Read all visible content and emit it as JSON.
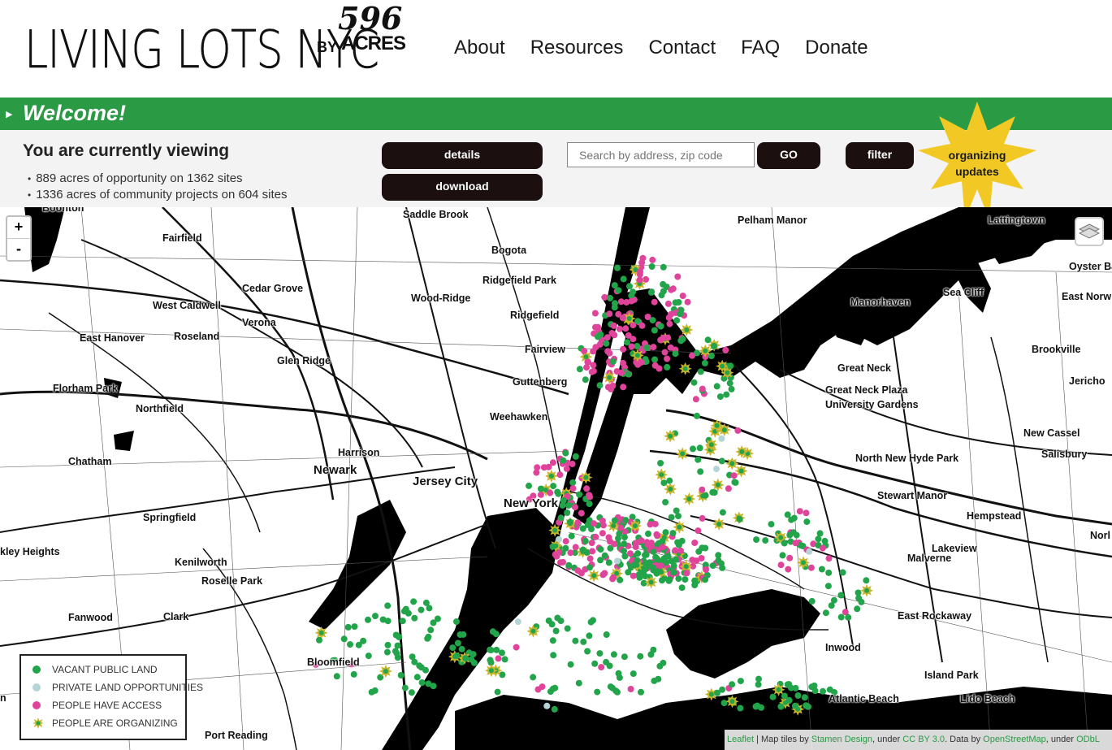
{
  "header": {
    "logo_main": "LIVING LOTS NYC",
    "logo_by": "BY",
    "logo_num": "596",
    "logo_acres": "ACRES",
    "nav": [
      "About",
      "Resources",
      "Contact",
      "FAQ",
      "Donate"
    ]
  },
  "welcome": {
    "title": "Welcome!"
  },
  "panel": {
    "heading": "You are currently viewing",
    "stats": [
      "889 acres of opportunity on 1362 sites",
      "1336 acres of community projects on 604 sites"
    ],
    "details_label": "details",
    "download_label": "download",
    "search_placeholder": "Search by address, zip code",
    "go_label": "GO",
    "filter_label": "filter",
    "organizing_line1": "organizing",
    "organizing_line2": "updates"
  },
  "map": {
    "zoom_in": "+",
    "zoom_out": "-",
    "places": [
      "Boonton",
      "Saddle Brook",
      "Pelham Manor",
      "Lattingtown",
      "Fairfield",
      "Bogota",
      "Oyster Bay",
      "Cedar Grove",
      "Ridgefield Park",
      "Sea Cliff",
      "East Norw",
      "West Caldwell",
      "Wood-Ridge",
      "Ridgefield",
      "Manorhaven",
      "Verona",
      "East Hanover",
      "Roseland",
      "Brookville",
      "Fairview",
      "Glen Ridge",
      "Great Neck",
      "Jericho",
      "Guttenberg",
      "Great Neck Plaza",
      "Florham Park",
      "University Gardens",
      "Northfield",
      "Weehawken",
      "New Cassel",
      "Harrison",
      "Salisbury",
      "Chatham",
      "North New Hyde Park",
      "Newark",
      "Jersey City",
      "Stewart Manor",
      "New York",
      "Springfield",
      "Hempstead",
      "Lakeview",
      "Norl",
      "Malverne",
      "kley Heights",
      "Kenilworth",
      "Roselle Park",
      "Fanwood",
      "Clark",
      "East Rockaway",
      "Inwood",
      "Bloomfield",
      "Island Park",
      "Atlantic Beach",
      "Lido Beach",
      "Port Reading",
      "n"
    ],
    "legend": [
      {
        "label": "VACANT PUBLIC LAND",
        "color": "#22a44a"
      },
      {
        "label": "PRIVATE LAND OPPORTUNITIES",
        "color": "#b5d4d5"
      },
      {
        "label": "PEOPLE HAVE ACCESS",
        "color": "#e0449a"
      },
      {
        "label": "PEOPLE ARE ORGANIZING",
        "color": "#c9b52a"
      }
    ],
    "attribution": {
      "leaflet": "Leaflet",
      "t1": " | Map tiles by ",
      "stamen": "Stamen Design",
      "t2": ", under ",
      "ccby": "CC BY 3.0",
      "t3": ". Data by ",
      "osm": "OpenStreetMap",
      "t4": ", under ",
      "odbl": "ODbL"
    }
  },
  "colors": {
    "brand_green": "#2a9a45",
    "button_dark": "#1b0f0f",
    "star_yellow": "#f2c924",
    "water": "#000000"
  }
}
